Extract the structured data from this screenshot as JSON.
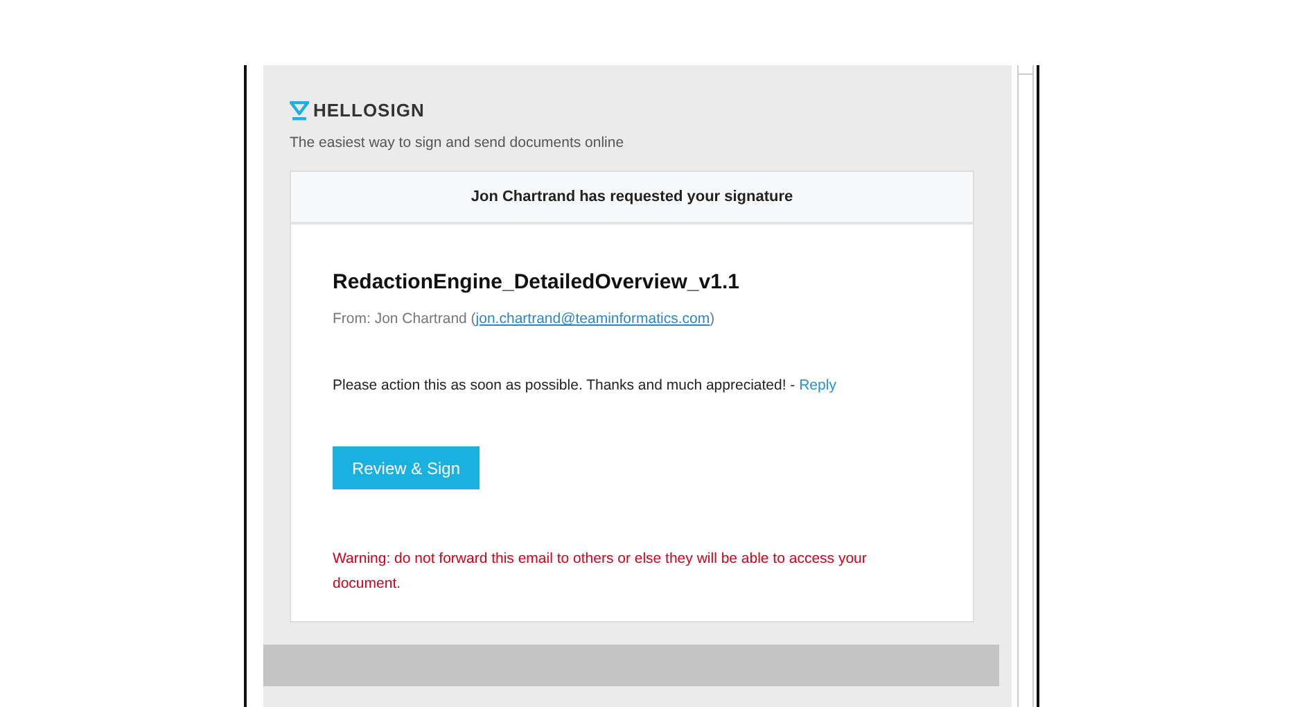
{
  "brand": {
    "name": "HELLOSIGN",
    "tagline": "The easiest way to sign and send documents online"
  },
  "card": {
    "header": "Jon Chartrand has requested your signature",
    "document_title": "RedactionEngine_DetailedOverview_v1.1",
    "from_label": "From: Jon Chartrand (",
    "from_email": "jon.chartrand@teaminformatics.com",
    "from_close": ")",
    "message": "Please action this as soon as possible. Thanks and much appreciated! - ",
    "reply_link": "Reply",
    "button": "Review & Sign",
    "warning": "Warning: do not forward this email to others or else they will be able to access your document."
  }
}
